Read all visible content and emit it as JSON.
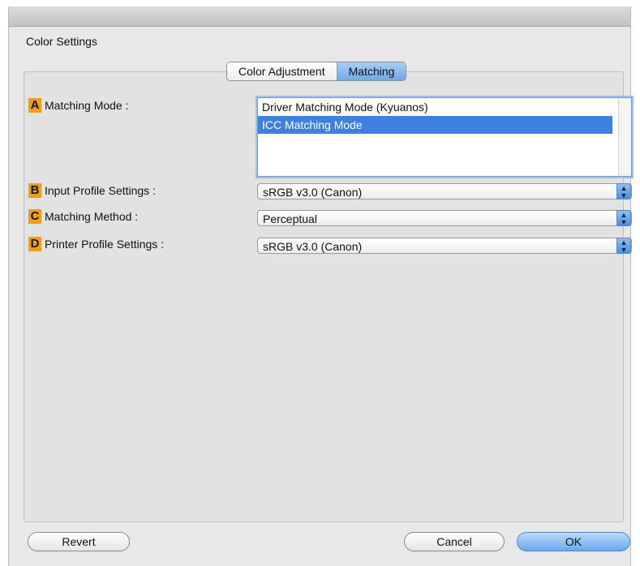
{
  "window": {
    "title": "Color Settings"
  },
  "tabs": [
    {
      "label": "Color Adjustment",
      "active": false
    },
    {
      "label": "Matching",
      "active": true
    }
  ],
  "matching_mode": {
    "letter": "A",
    "label": "Matching Mode :",
    "options": [
      {
        "label": "Driver Matching Mode (Kyuanos)",
        "selected": false
      },
      {
        "label": "ICC Matching Mode",
        "selected": true
      }
    ]
  },
  "input_profile": {
    "letter": "B",
    "label": "Input Profile Settings :",
    "value": "sRGB v3.0 (Canon)"
  },
  "matching_method": {
    "letter": "C",
    "label": "Matching Method :",
    "value": "Perceptual"
  },
  "printer_profile": {
    "letter": "D",
    "label": "Printer Profile Settings :",
    "value": "sRGB v3.0 (Canon)"
  },
  "buttons": {
    "revert": "Revert",
    "cancel": "Cancel",
    "ok": "OK"
  },
  "colors": {
    "accent": "#3d80df",
    "letter_badge": "#f29b1c"
  },
  "icons": {
    "popup_arrows": "updown-arrows-icon"
  }
}
